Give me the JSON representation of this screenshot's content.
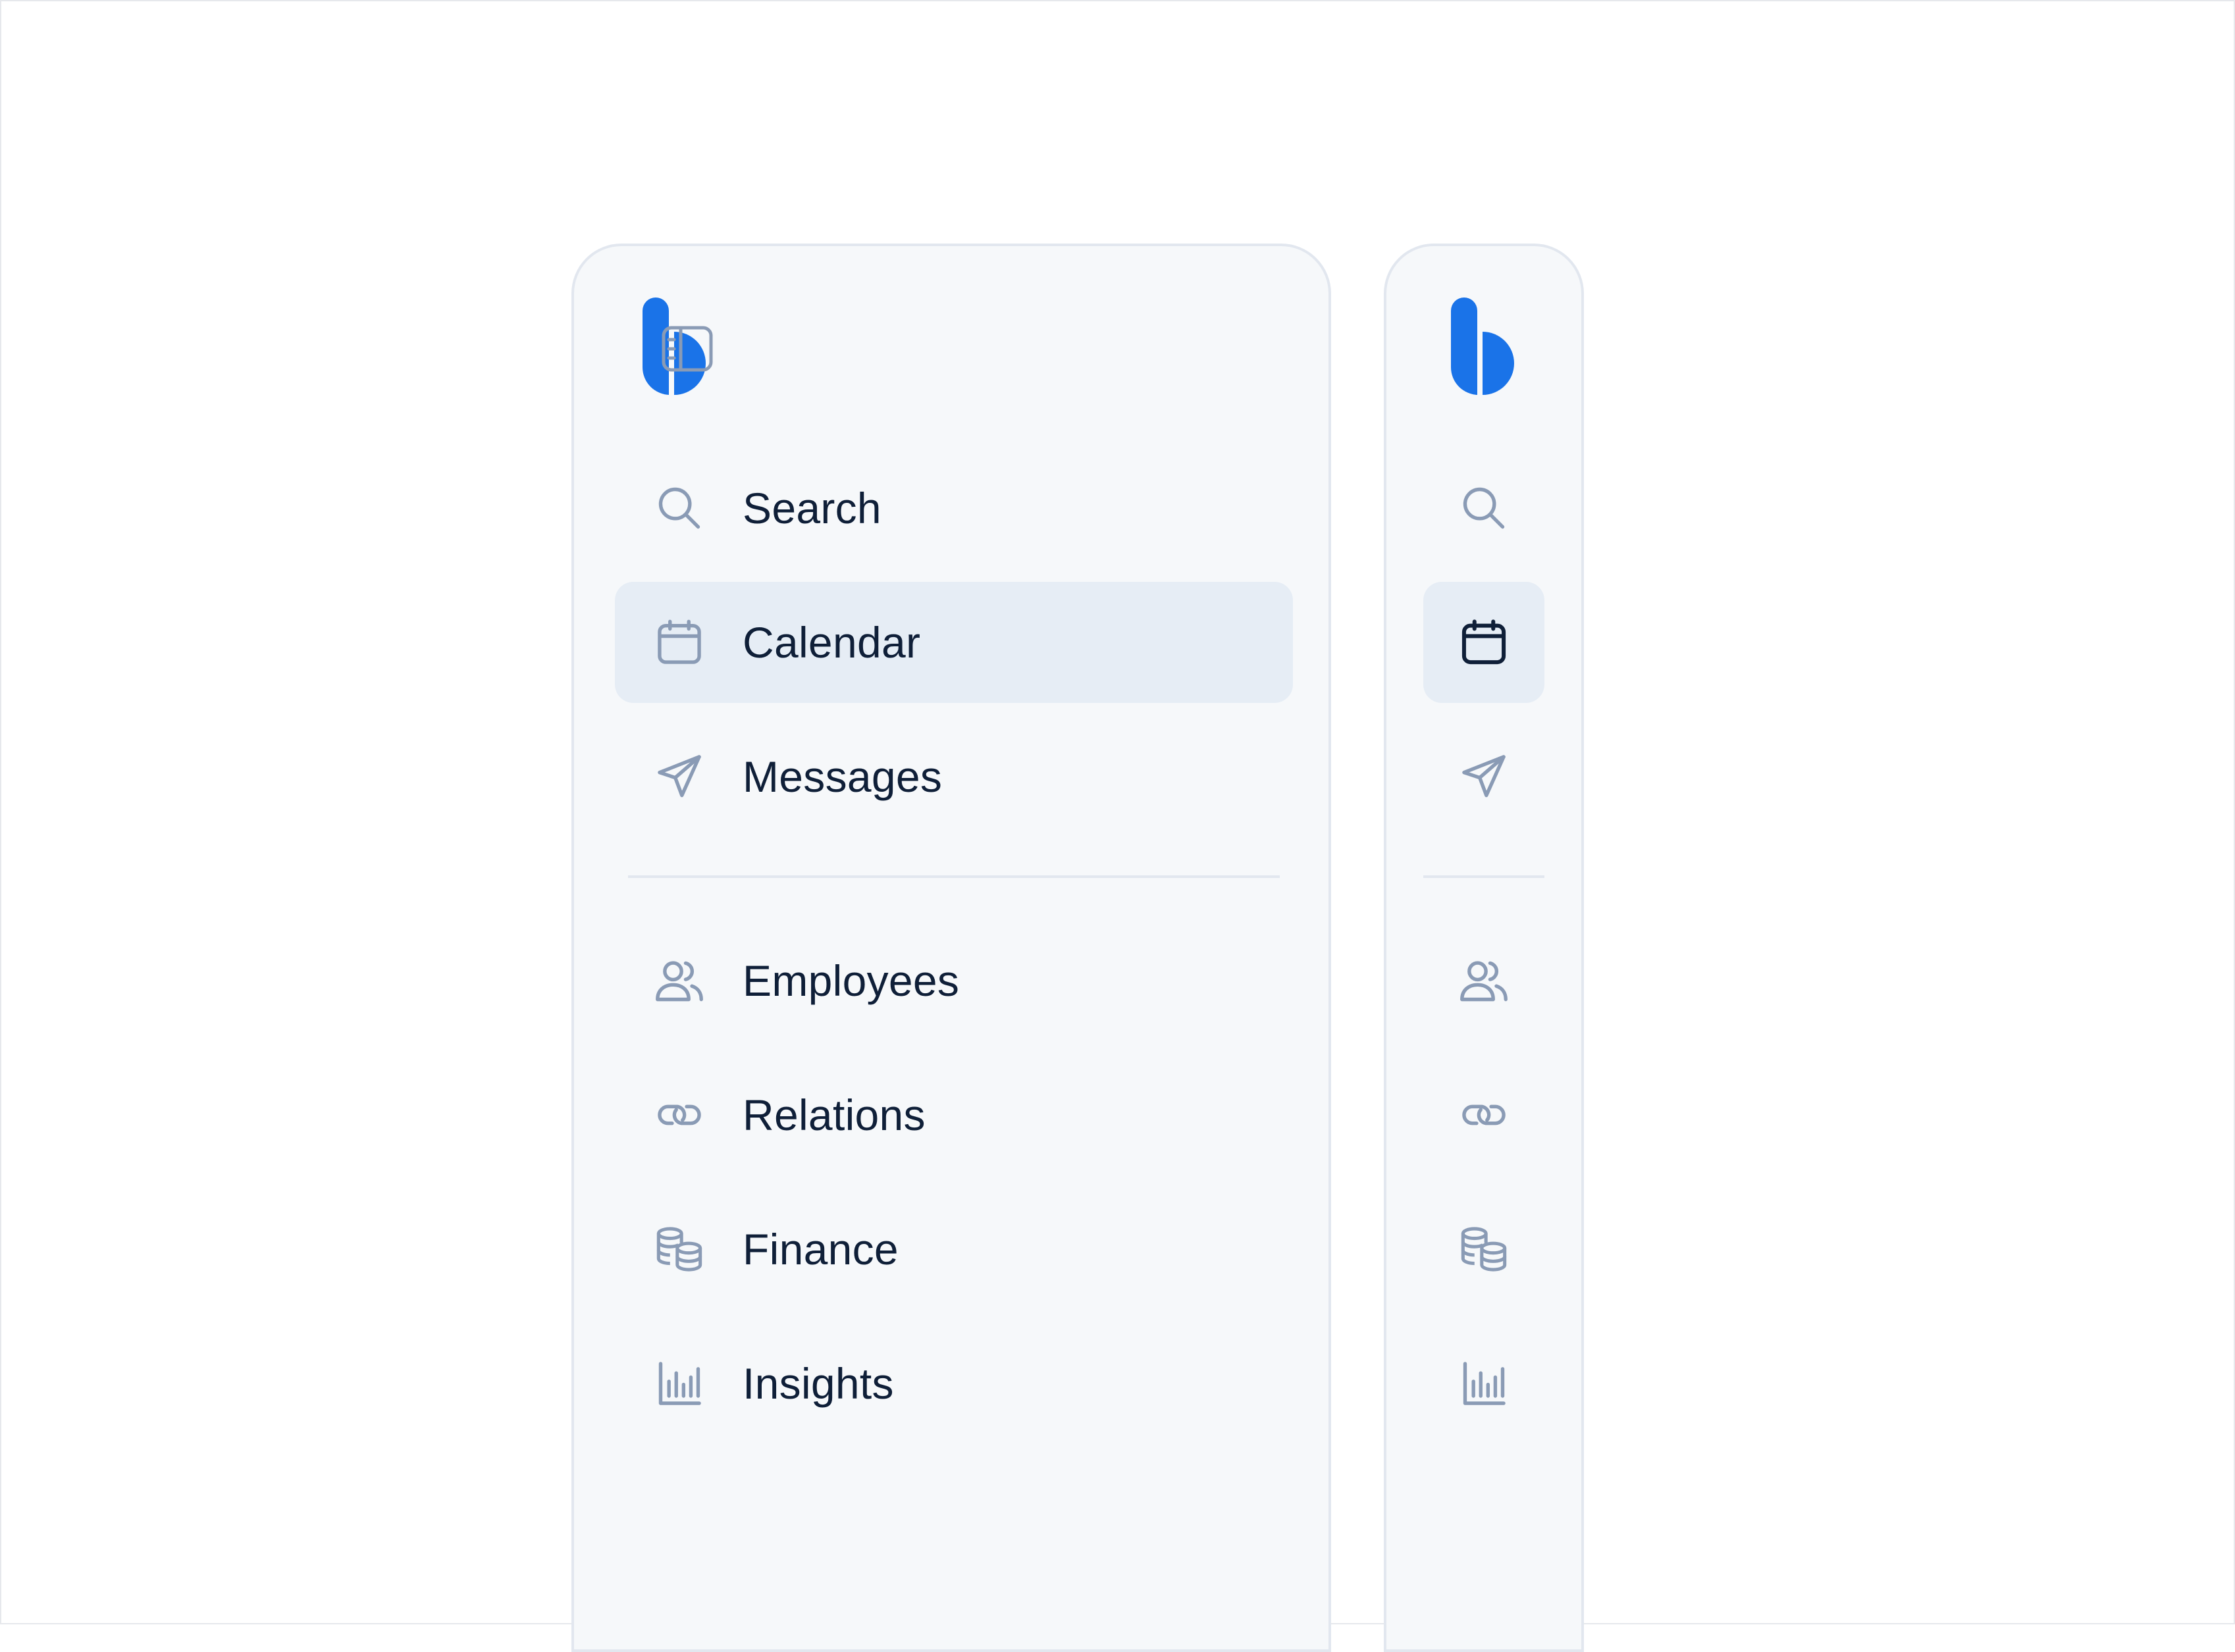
{
  "expanded_sidebar": {
    "nav_primary": [
      {
        "id": "search",
        "label": "Search",
        "icon": "search-icon",
        "active": false
      },
      {
        "id": "calendar",
        "label": "Calendar",
        "icon": "calendar-icon",
        "active": true
      },
      {
        "id": "messages",
        "label": "Messages",
        "icon": "send-icon",
        "active": false
      }
    ],
    "nav_secondary": [
      {
        "id": "employees",
        "label": "Employees",
        "icon": "users-icon",
        "active": false
      },
      {
        "id": "relations",
        "label": "Relations",
        "icon": "link-icon",
        "active": false
      },
      {
        "id": "finance",
        "label": "Finance",
        "icon": "coins-icon",
        "active": false
      },
      {
        "id": "insights",
        "label": "Insights",
        "icon": "bar-chart-icon",
        "active": false
      }
    ],
    "toggle_icon": "sidebar-toggle-icon"
  },
  "collapsed_sidebar": {
    "nav_icons": [
      "search-icon",
      "calendar-icon",
      "send-icon",
      "users-icon",
      "link-icon",
      "coins-icon",
      "bar-chart-icon"
    ],
    "active": "calendar-icon"
  },
  "colors": {
    "brand": "#1a73e8",
    "icon_muted": "#8a9bb5",
    "icon_active": "#0f1f38",
    "text": "#0f1f38",
    "sidebar_bg": "#f6f8fa",
    "active_bg": "#e6edf5",
    "border": "#e2e7ef"
  }
}
